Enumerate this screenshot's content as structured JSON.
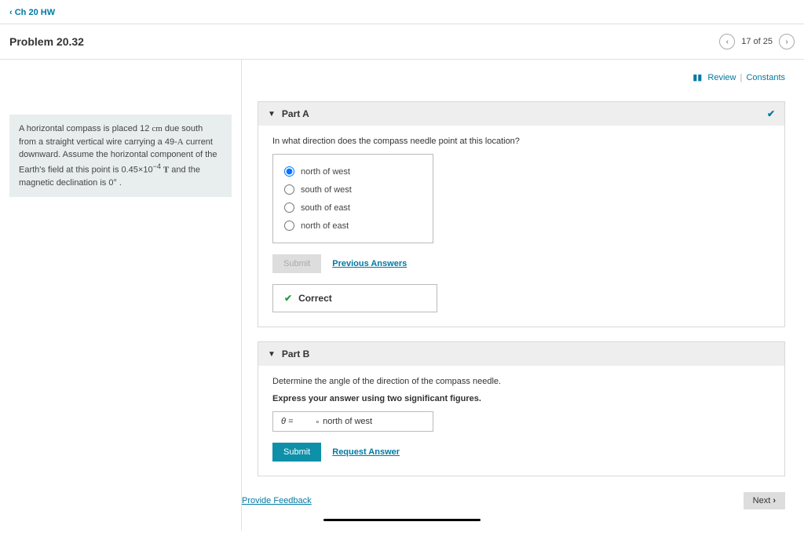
{
  "nav": {
    "back_link": "Ch 20 HW",
    "problem_title": "Problem 20.32",
    "counter": "17 of 25"
  },
  "utility": {
    "review": "Review",
    "constants": "Constants"
  },
  "problem_text": {
    "line1_a": "A horizontal compass is placed 12 ",
    "line1_unit1": "cm",
    "line1_b": " due south from a straight vertical wire carrying a 49-",
    "line1_unit2": "A",
    "line1_c": " current downward. Assume the horizontal component of the Earth's field at this point is 0.45×10",
    "exp": "−4",
    "line1_d": " ",
    "line1_unit3": "T",
    "line1_e": " and the magnetic declination is 0",
    "deg": "°",
    "line1_f": " ."
  },
  "partA": {
    "title": "Part A",
    "question": "In what direction does the compass needle point at this location?",
    "options": [
      "north of west",
      "south of west",
      "south of east",
      "north of east"
    ],
    "submit": "Submit",
    "prev_answers": "Previous Answers",
    "feedback": "Correct"
  },
  "partB": {
    "title": "Part B",
    "question": "Determine the angle of the direction of the compass needle.",
    "instruction": "Express your answer using two significant figures.",
    "theta": "θ =",
    "unit_suffix": "north of west",
    "submit": "Submit",
    "request": "Request Answer"
  },
  "footer": {
    "provide_feedback": "Provide Feedback",
    "next": "Next"
  }
}
